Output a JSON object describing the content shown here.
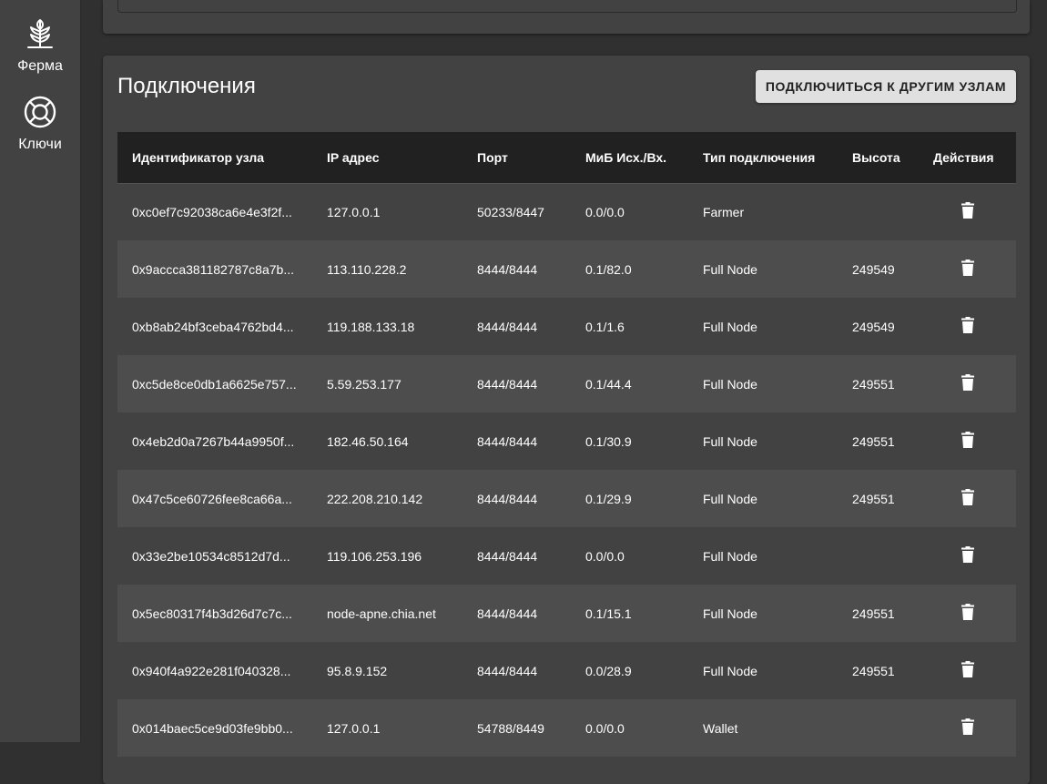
{
  "sidebar": {
    "items": [
      {
        "label": "Ферма",
        "icon": "seedling-icon"
      },
      {
        "label": "Ключи",
        "icon": "lifebuoy-icon"
      }
    ]
  },
  "connections": {
    "title": "Подключения",
    "connect_button": "ПОДКЛЮЧИТЬСЯ К ДРУГИМ УЗЛАМ",
    "columns": [
      "Идентификатор узла",
      "IP адрес",
      "Порт",
      "МиБ Исх./Вх.",
      "Тип подключения",
      "Высота",
      "Действия"
    ],
    "rows": [
      {
        "node_id": "0xc0ef7c92038ca6e4e3f2f...",
        "ip": "127.0.0.1",
        "port": "50233/8447",
        "mib": "0.0/0.0",
        "type": "Farmer",
        "height": ""
      },
      {
        "node_id": "0x9accca381182787c8a7b...",
        "ip": "113.110.228.2",
        "port": "8444/8444",
        "mib": "0.1/82.0",
        "type": "Full Node",
        "height": "249549"
      },
      {
        "node_id": "0xb8ab24bf3ceba4762bd4...",
        "ip": "119.188.133.18",
        "port": "8444/8444",
        "mib": "0.1/1.6",
        "type": "Full Node",
        "height": "249549"
      },
      {
        "node_id": "0xc5de8ce0db1a6625e757...",
        "ip": "5.59.253.177",
        "port": "8444/8444",
        "mib": "0.1/44.4",
        "type": "Full Node",
        "height": "249551"
      },
      {
        "node_id": "0x4eb2d0a7267b44a9950f...",
        "ip": "182.46.50.164",
        "port": "8444/8444",
        "mib": "0.1/30.9",
        "type": "Full Node",
        "height": "249551"
      },
      {
        "node_id": "0x47c5ce60726fee8ca66a...",
        "ip": "222.208.210.142",
        "port": "8444/8444",
        "mib": "0.1/29.9",
        "type": "Full Node",
        "height": "249551"
      },
      {
        "node_id": "0x33e2be10534c8512d7d...",
        "ip": "119.106.253.196",
        "port": "8444/8444",
        "mib": "0.0/0.0",
        "type": "Full Node",
        "height": ""
      },
      {
        "node_id": "0x5ec80317f4b3d26d7c7c...",
        "ip": "node-apne.chia.net",
        "port": "8444/8444",
        "mib": "0.1/15.1",
        "type": "Full Node",
        "height": "249551"
      },
      {
        "node_id": "0x940f4a922e281f040328...",
        "ip": "95.8.9.152",
        "port": "8444/8444",
        "mib": "0.0/28.9",
        "type": "Full Node",
        "height": "249551"
      },
      {
        "node_id": "0x014baec5ce9d03fe9bb0...",
        "ip": "127.0.0.1",
        "port": "54788/8449",
        "mib": "0.0/0.0",
        "type": "Wallet",
        "height": ""
      }
    ]
  }
}
